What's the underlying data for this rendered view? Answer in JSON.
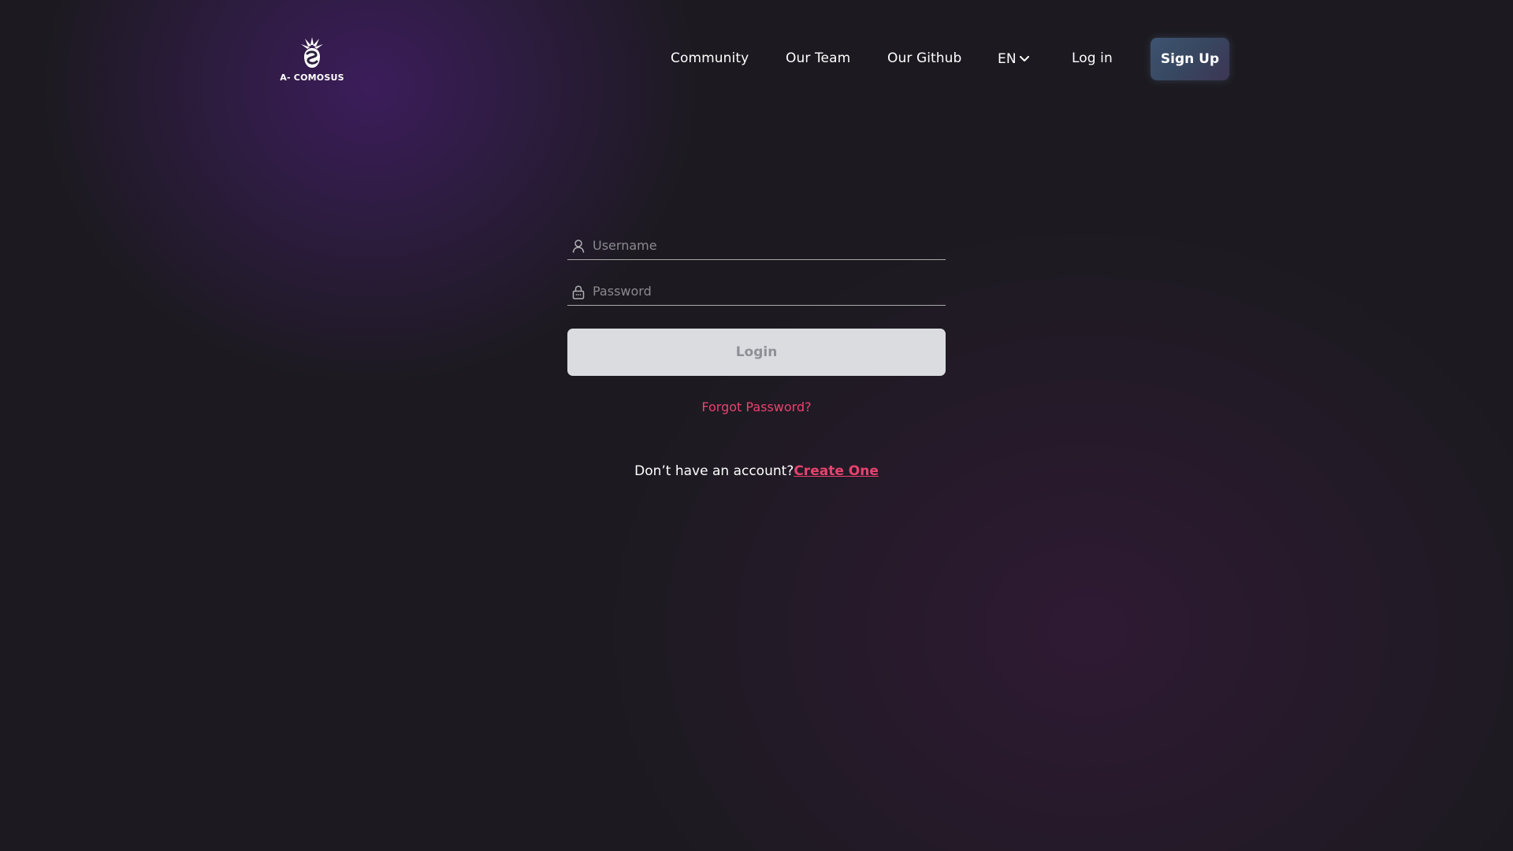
{
  "brand": {
    "logo_text": "A- COMOSUS",
    "logo_icon": "pineapple-logo-icon"
  },
  "nav": {
    "items": [
      {
        "label": "Community"
      },
      {
        "label": "Our Team"
      },
      {
        "label": "Our Github"
      }
    ],
    "language": {
      "label": "EN",
      "icon": "chevron-down-icon"
    },
    "login_label": "Log in",
    "signup_label": "Sign Up"
  },
  "form": {
    "username": {
      "placeholder": "Username",
      "value": "",
      "icon": "user-icon"
    },
    "password": {
      "placeholder": "Password",
      "value": "",
      "icon": "lock-icon"
    },
    "login_button": "Login",
    "forgot_password": "Forgot Password?",
    "no_account_text": "Don’t have an account?",
    "create_link": "Create One"
  },
  "colors": {
    "background": "#1c1a20",
    "accent": "#e8436e",
    "login_button_bg": "#dadce0",
    "signup_button_bg": "#3d5470"
  }
}
